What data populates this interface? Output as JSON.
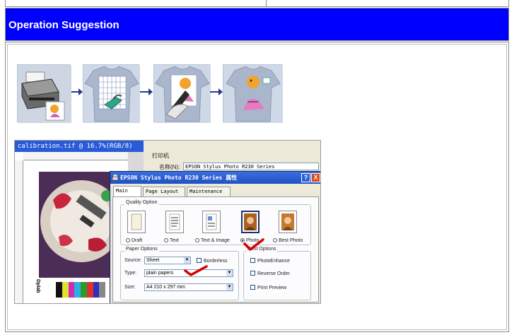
{
  "banner": {
    "title": "Operation Suggestion"
  },
  "colors": {
    "banner": "#0000ff",
    "banner_text": "#ffffff",
    "check": "#d40000"
  },
  "steps": [
    {
      "icon": "printer-icon"
    },
    {
      "icon": "tshirt-iron-icon"
    },
    {
      "icon": "tshirt-peel-icon"
    },
    {
      "icon": "tshirt-print-icon"
    }
  ],
  "screenshot": {
    "ps_title": "calibration.tif @ 16.7%(RGB/8)",
    "ps_vertical_text": "Dplab",
    "print_window": {
      "title": "打印机",
      "name_label": "名称(N):",
      "name_value": "EPSON Stylus Photo R230 Series"
    },
    "dialog": {
      "title": "EPSON Stylus Photo R230 Series 属性",
      "help_btn": "?",
      "close_btn": "X",
      "tabs": [
        "Main",
        "Page Layout",
        "Maintenance"
      ],
      "quality_group": "Quality Option",
      "quality_options": [
        "Draft",
        "Text",
        "Text & Image",
        "Photo",
        "Best Photo"
      ],
      "selected_quality": "Photo",
      "paper_group": "Paper Options",
      "source_label": "Source:",
      "source_value": "Sheet",
      "borderless": "Borderless",
      "type_label": "Type:",
      "type_value": "plain papers",
      "size_label": "Size:",
      "size_value": "A4 210 x 297 mm",
      "print_group": "Print Options",
      "print_options": [
        "PhotoEnhance",
        "Reverse Order",
        "Print Preview"
      ]
    }
  }
}
